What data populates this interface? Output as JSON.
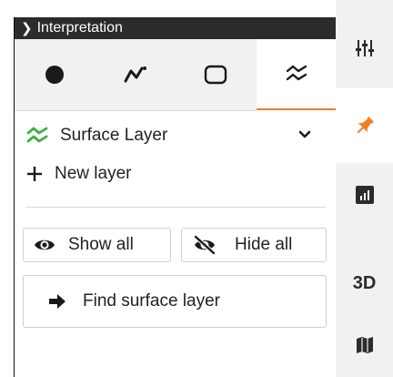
{
  "panel": {
    "title": "Interpretation",
    "tabs": [
      {
        "icon": "circle-icon",
        "active": false
      },
      {
        "icon": "polyline-icon",
        "active": false
      },
      {
        "icon": "rounded-square-icon",
        "active": false
      },
      {
        "icon": "surface-layers-icon",
        "active": true
      }
    ],
    "layer_selector": {
      "label": "Surface Layer",
      "icon": "surface-layers-icon",
      "icon_color": "#3cb043"
    },
    "new_layer": {
      "label": "New layer",
      "icon": "plus-icon"
    },
    "show_all": {
      "label": "Show all",
      "icon": "eye-icon"
    },
    "hide_all": {
      "label": "Hide all",
      "icon": "eye-slash-icon"
    },
    "find_surface": {
      "label": "Find surface layer",
      "icon": "arrow-right-icon"
    }
  },
  "sidebar": {
    "items": [
      {
        "name": "sliders",
        "icon": "sliders-icon"
      },
      {
        "name": "pin",
        "icon": "pin-icon",
        "active": true,
        "color": "#f07d22"
      },
      {
        "name": "chart",
        "icon": "bar-chart-icon"
      },
      {
        "name": "3d",
        "label": "3D"
      },
      {
        "name": "map",
        "icon": "map-icon"
      }
    ]
  },
  "colors": {
    "accent": "#f07d22",
    "title_bar": "#2b2b2b",
    "tab_background": "#f1f1f1",
    "layer_green": "#3cb043"
  }
}
